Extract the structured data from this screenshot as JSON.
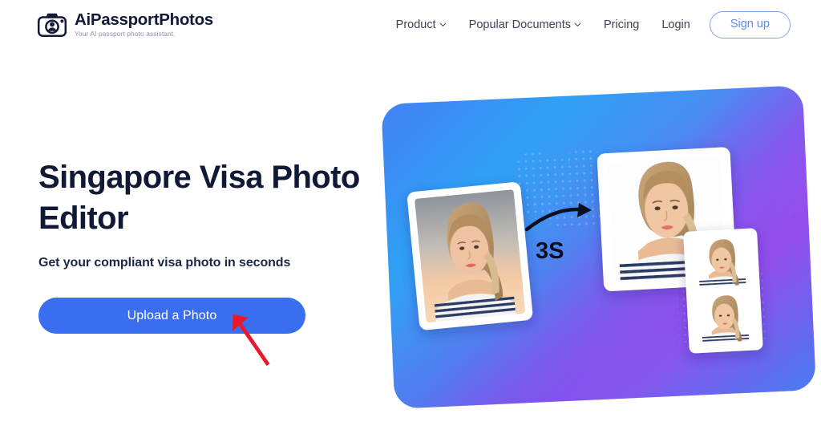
{
  "brand": {
    "name": "AiPassportPhotos",
    "tagline": "Your AI passport photo assistant.",
    "icon": "camera-icon"
  },
  "nav": {
    "items": [
      {
        "label": "Product",
        "has_dropdown": true,
        "icon": "chevron-down-icon"
      },
      {
        "label": "Popular Documents",
        "has_dropdown": true,
        "icon": "chevron-down-icon"
      },
      {
        "label": "Pricing",
        "has_dropdown": false
      },
      {
        "label": "Login",
        "has_dropdown": false
      }
    ],
    "signup_label": "Sign up"
  },
  "hero": {
    "title": "Singapore Visa Photo Editor",
    "subtitle": "Get your compliant visa photo in seconds",
    "upload_label": "Upload a Photo"
  },
  "illustration": {
    "speed_label": "3S",
    "arrow_icon": "curved-arrow-icon",
    "before_photo_alt": "before-passport-photo",
    "after_photo_alt": "after-passport-photo",
    "thumbnails_alt": "passport-photo-sheet"
  },
  "annotation": {
    "icon": "red-pointer-arrow-icon"
  },
  "colors": {
    "brand_dark": "#101936",
    "accent_blue": "#3a6ef0",
    "signup_border": "#7ea2f7",
    "signup_text": "#5b8af5",
    "nav_text": "#3c4257",
    "tagline_gray": "#8e94a8",
    "annotation_red": "#e8192c",
    "gradient_blue": "#2f9bf2",
    "gradient_violet": "#6b4fe8",
    "gradient_magenta": "#c64bf0",
    "page_bg": "#ffffff"
  }
}
